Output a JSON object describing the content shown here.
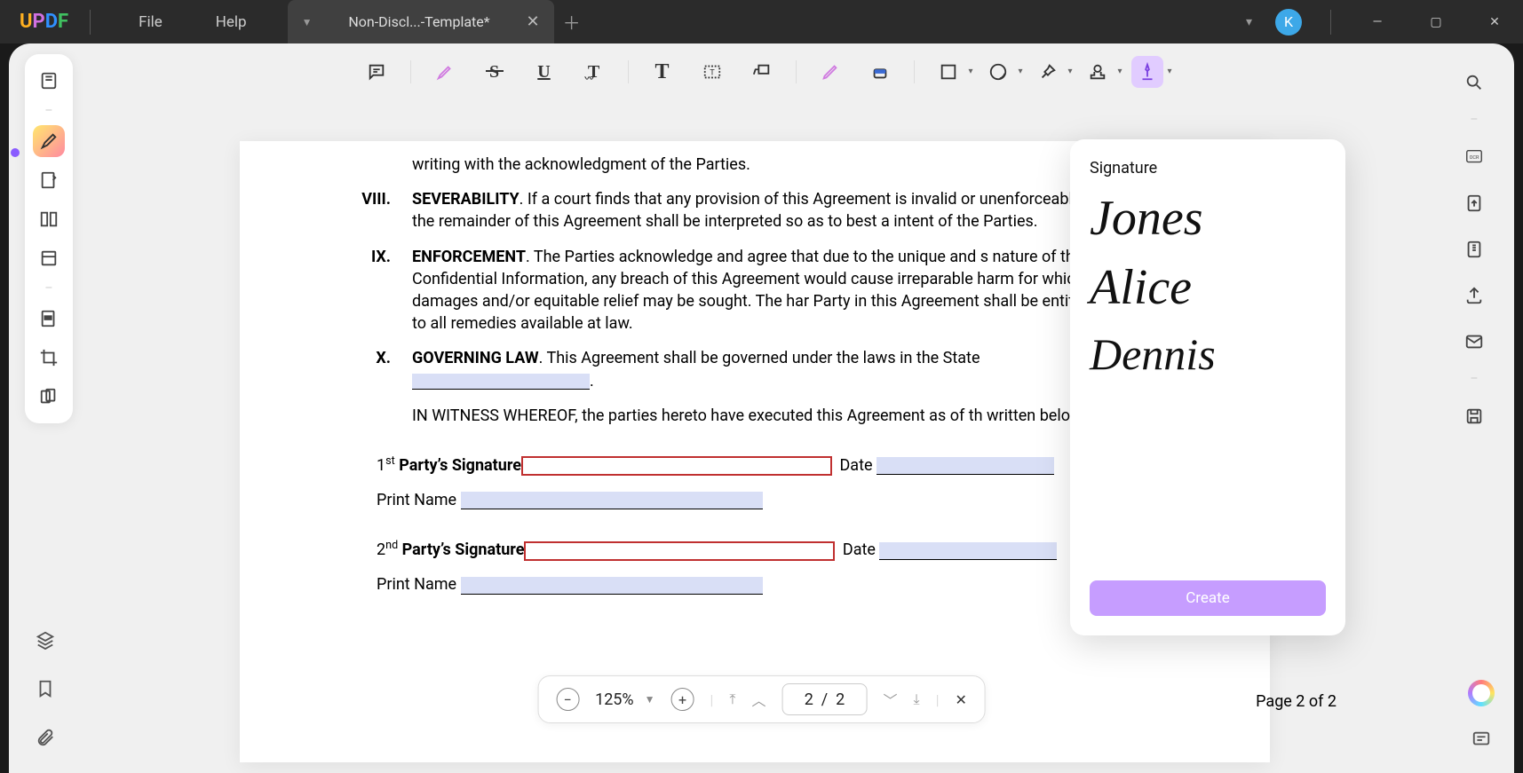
{
  "app_name": "UPDF",
  "menus": {
    "file": "File",
    "help": "Help"
  },
  "tab": {
    "name": "Non-Discl...-Template*"
  },
  "avatar_initial": "K",
  "toolbar_names": {
    "note": "note-icon",
    "highlight": "highlighter-icon",
    "strike": "strikethrough-icon",
    "underline": "underline-icon",
    "squiggly": "squiggly-icon",
    "text": "text-icon",
    "textbox": "textbox-icon",
    "callout": "callout-icon",
    "pencil": "pencil-icon",
    "eraser": "eraser-icon",
    "shape": "rectangle-icon",
    "sticker": "sticker-icon",
    "attach": "attachment-icon",
    "stamp": "stamp-icon",
    "sign": "signature-icon"
  },
  "signature_panel": {
    "title": "Signature",
    "items": [
      "Jones",
      "Alice",
      "Dennis"
    ],
    "create_btn": "Create"
  },
  "document": {
    "line_top": "writing with the acknowledgment of the Parties.",
    "s8": {
      "num": "VIII.",
      "title": "SEVERABILITY",
      "text": ". If a court finds that any provision of this Agreement is invalid or unenforceable, the remainder of this Agreement shall be interpreted so as to best a intent of the Parties."
    },
    "s9": {
      "num": "IX.",
      "title": "ENFORCEMENT",
      "text": ". The Parties acknowledge and agree that due to the unique and s nature of the Confidential Information, any breach of this Agreement would cause irreparable harm for which damages and/or equitable relief may be sought. The har Party in this Agreement shall be entitled to all remedies available at law."
    },
    "s10": {
      "num": "X.",
      "title": "GOVERNING LAW",
      "text": ". This Agreement shall be governed under the laws in the State "
    },
    "s10_tail": ".",
    "witness": "IN WITNESS WHEREOF, the parties hereto have executed this Agreement as of th written below.",
    "party1_sig_label": "1st Party’s Signature",
    "party2_sig_label": "2nd Party’s Signature",
    "print_name_label": "Print Name",
    "date_label": "Date"
  },
  "zoom": {
    "value": "125%",
    "page_input": "2  /  2"
  },
  "page_counter": "Page 2 of 2"
}
